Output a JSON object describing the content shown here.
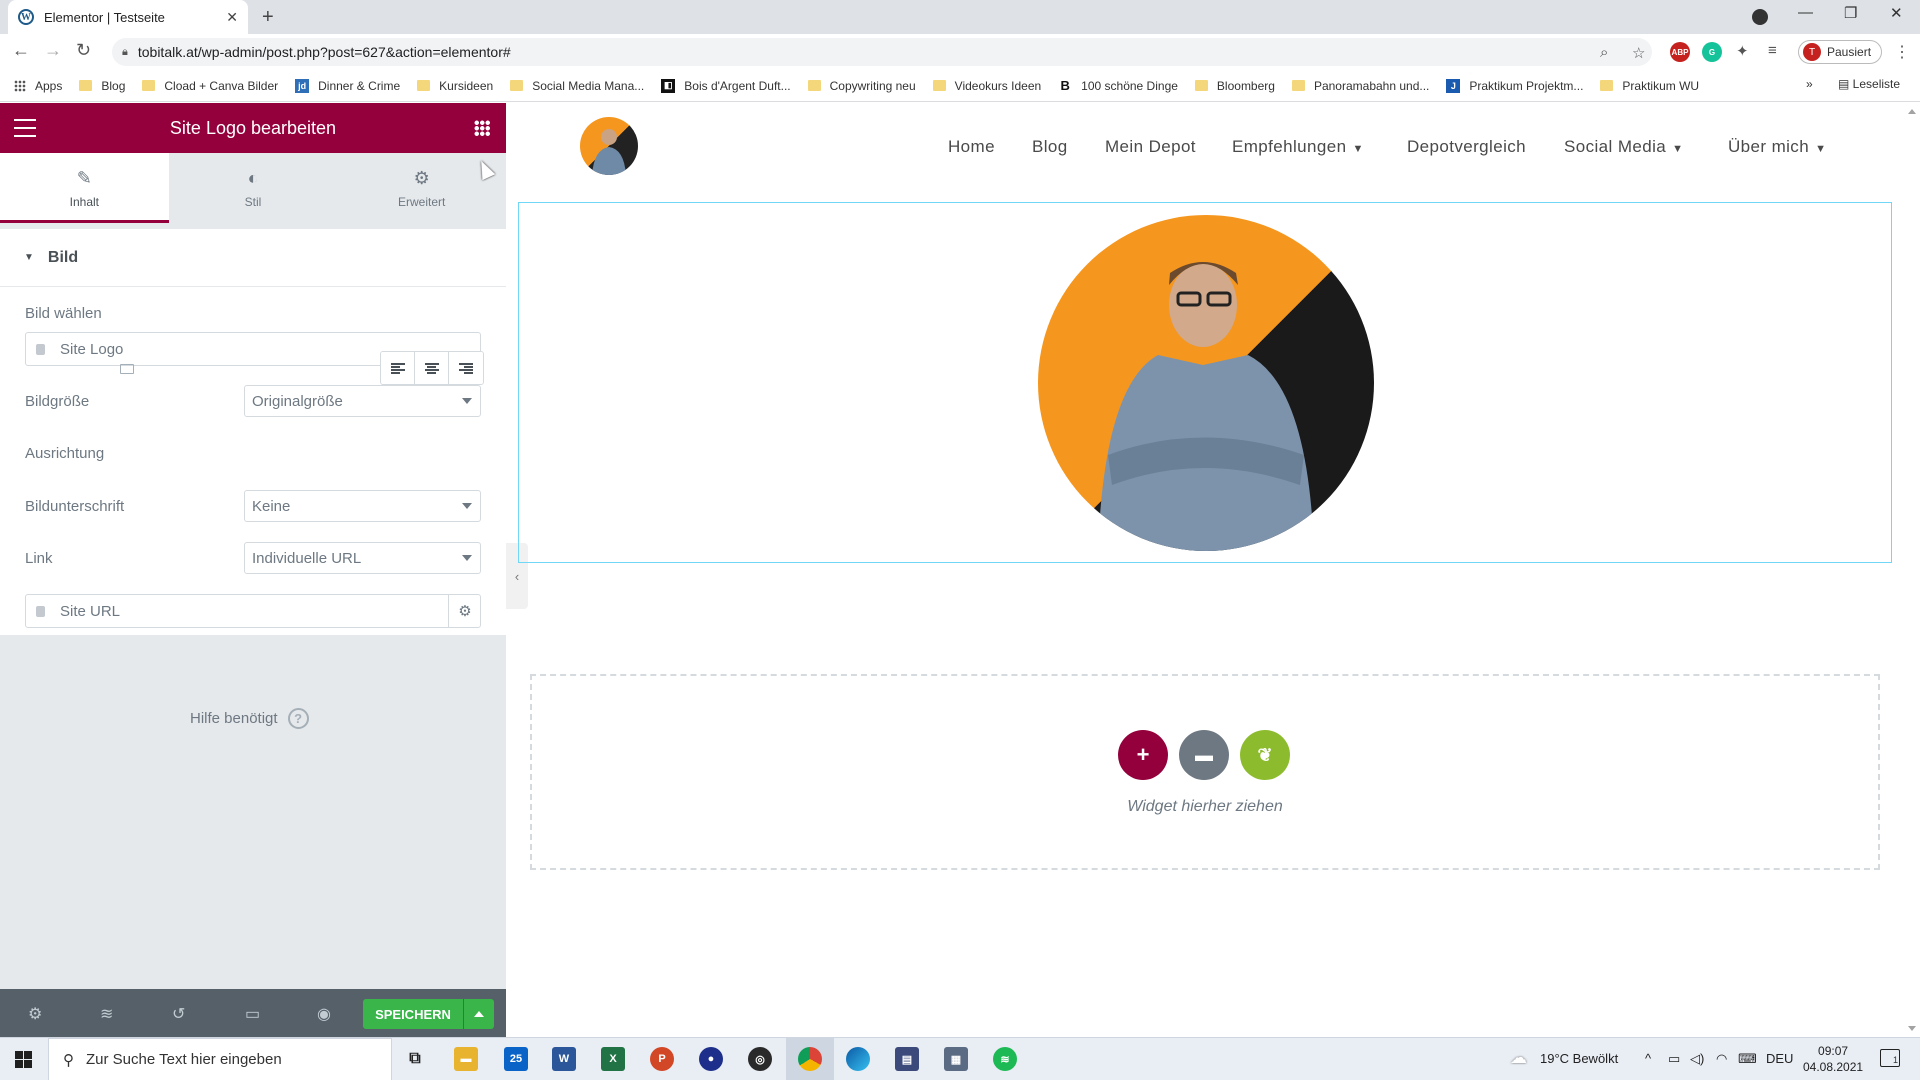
{
  "browser": {
    "tab_title": "Elementor | Testseite",
    "url": "tobitalk.at/wp-admin/post.php?post=627&action=elementor#",
    "profile_label": "Pausiert",
    "profile_initial": "T",
    "reading_list": "Leseliste",
    "bookmarks": [
      {
        "label": "Apps",
        "icon": "apps-grid-icon"
      },
      {
        "label": "Blog",
        "icon": "folder-icon"
      },
      {
        "label": "Cload + Canva Bilder",
        "icon": "folder-icon"
      },
      {
        "label": "Dinner & Crime",
        "icon": "jd-icon"
      },
      {
        "label": "Kursideen",
        "icon": "folder-icon"
      },
      {
        "label": "Social Media Mana...",
        "icon": "folder-icon"
      },
      {
        "label": "Bois d'Argent Duft...",
        "icon": "bois-icon"
      },
      {
        "label": "Copywriting neu",
        "icon": "folder-icon"
      },
      {
        "label": "Videokurs Ideen",
        "icon": "folder-icon"
      },
      {
        "label": "100 schöne Dinge",
        "icon": "b-icon"
      },
      {
        "label": "Bloomberg",
        "icon": "folder-icon"
      },
      {
        "label": "Panoramabahn und...",
        "icon": "folder-icon"
      },
      {
        "label": "Praktikum Projektm...",
        "icon": "j-icon"
      },
      {
        "label": "Praktikum WU",
        "icon": "folder-icon"
      }
    ]
  },
  "panel": {
    "title": "Site Logo bearbeiten",
    "tabs": [
      {
        "label": "Inhalt",
        "icon": "pencil-icon",
        "active": true
      },
      {
        "label": "Stil",
        "icon": "half-circle-icon",
        "active": false
      },
      {
        "label": "Erweitert",
        "icon": "gear-icon",
        "active": false
      }
    ],
    "section_title": "Bild",
    "image_label": "Bild wählen",
    "image_value": "Site Logo",
    "size_label": "Bildgröße",
    "size_value": "Originalgröße",
    "align_label": "Ausrichtung",
    "caption_label": "Bildunterschrift",
    "caption_value": "Keine",
    "link_label": "Link",
    "link_value": "Individuelle URL",
    "url_value": "Site URL",
    "help_text": "Hilfe benötigt",
    "save_label": "SPEICHERN"
  },
  "site": {
    "nav": [
      {
        "label": "Home",
        "dropdown": false
      },
      {
        "label": "Blog",
        "dropdown": false
      },
      {
        "label": "Mein Depot",
        "dropdown": false
      },
      {
        "label": "Empfehlungen",
        "dropdown": true
      },
      {
        "label": "Depotvergleich",
        "dropdown": false
      },
      {
        "label": "Social Media",
        "dropdown": true
      },
      {
        "label": "Über mich",
        "dropdown": true
      }
    ],
    "drop_text": "Widget hierher ziehen"
  },
  "taskbar": {
    "search_placeholder": "Zur Suche Text hier eingeben",
    "mail_badge": "25",
    "weather": "19°C  Bewölkt",
    "lang": "DEU",
    "time": "09:07",
    "date": "04.08.2021",
    "notif_count": "1"
  },
  "colors": {
    "elementor_brand": "#93003c",
    "save_green": "#39b54a",
    "logo_orange": "#f5961e",
    "selection_blue": "#71d7f7"
  }
}
